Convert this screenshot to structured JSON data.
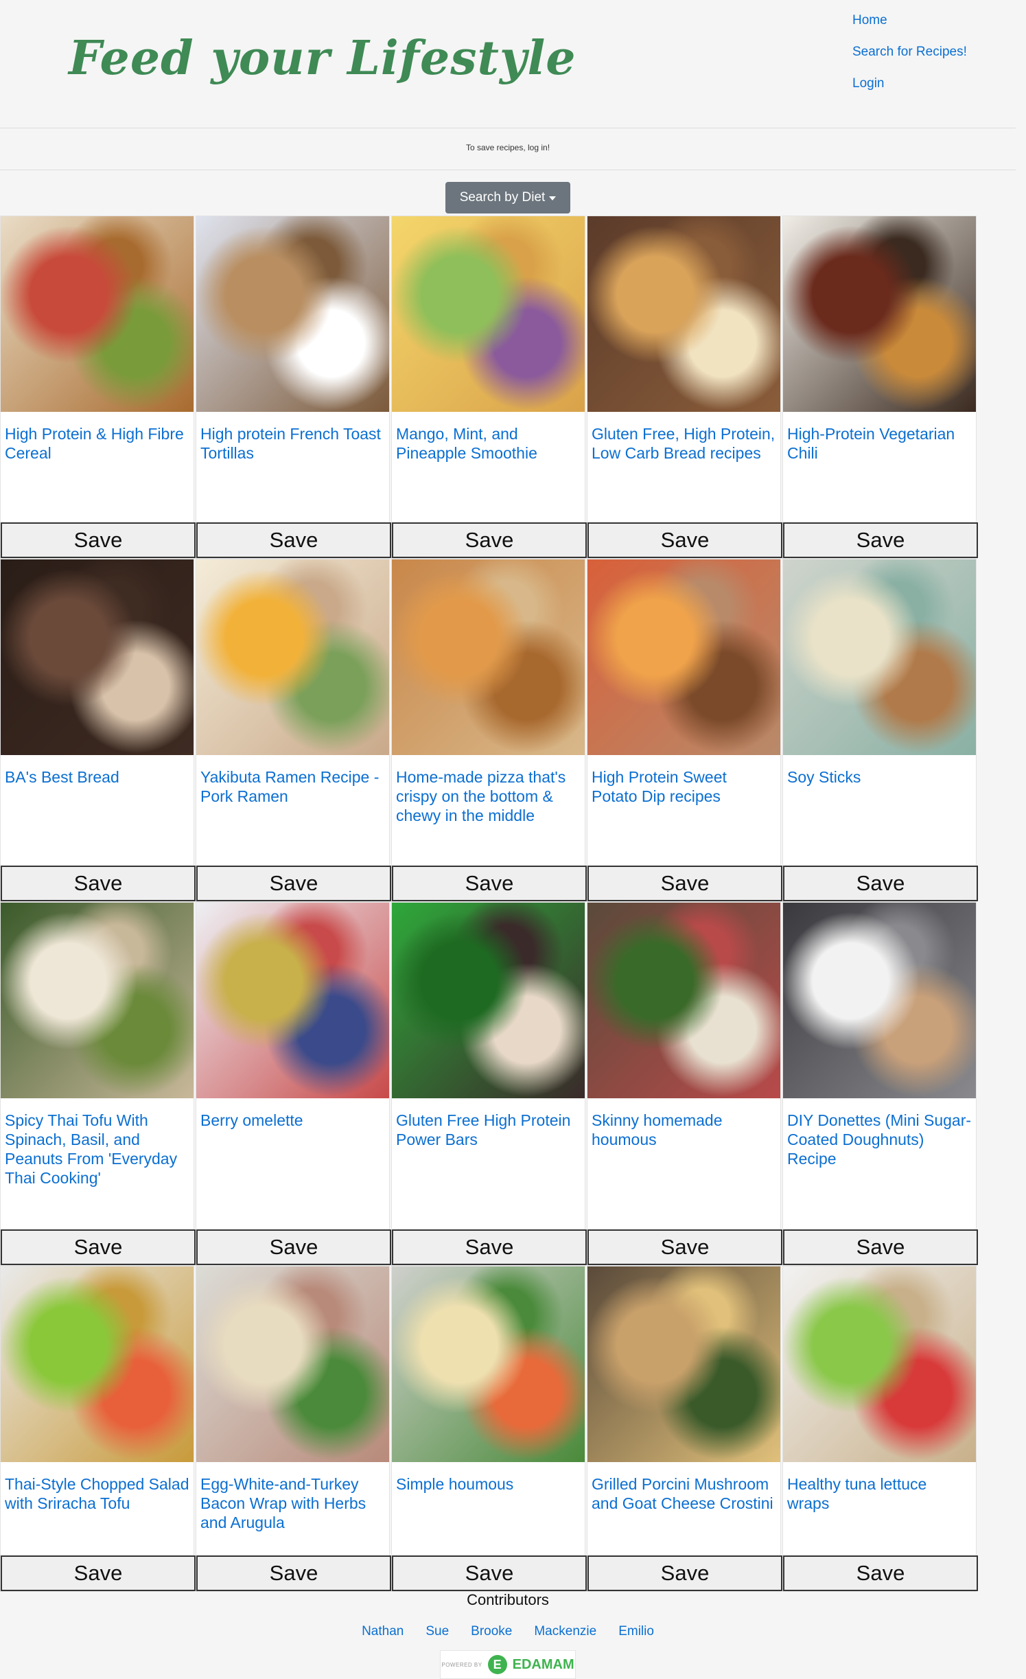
{
  "header": {
    "brand": "Feed your Lifestyle",
    "nav": [
      {
        "label": "Home"
      },
      {
        "label": "Search for Recipes!"
      },
      {
        "label": "Login"
      }
    ]
  },
  "notice": "To save recipes, log in!",
  "filter": {
    "label": "Search by Diet"
  },
  "save_label": "Save",
  "recipes": [
    {
      "title": "High Protein & High Fibre Cereal",
      "colors": [
        "#e9dcc6",
        "#c84a3a",
        "#7a9b3a",
        "#a86b2f"
      ]
    },
    {
      "title": "High protein French Toast Tortillas",
      "colors": [
        "#dfe3ee",
        "#b98f62",
        "#ffffff",
        "#7c5a3a"
      ]
    },
    {
      "title": "Mango, Mint, and Pineapple Smoothie",
      "colors": [
        "#f4d66b",
        "#8fbf5a",
        "#8a5a9c",
        "#d9a24a"
      ]
    },
    {
      "title": "Gluten Free, High Protein, Low Carb Bread recipes",
      "colors": [
        "#5b3b2a",
        "#d9a35a",
        "#f1e2c0",
        "#8a5d3a"
      ]
    },
    {
      "title": "High-Protein Vegetarian Chili",
      "colors": [
        "#f0ede6",
        "#6a2a1c",
        "#c98a3a",
        "#3a2a20"
      ]
    },
    {
      "title": "BA's Best Bread",
      "colors": [
        "#2a1d17",
        "#6b4a3a",
        "#d8c2aa",
        "#3e2b22"
      ]
    },
    {
      "title": "Yakibuta Ramen Recipe - Pork Ramen",
      "colors": [
        "#f4ecd8",
        "#f2b23a",
        "#7aa05a",
        "#c9a98a"
      ]
    },
    {
      "title": "Home-made pizza that's crispy on the bottom & chewy in the middle",
      "colors": [
        "#c9874a",
        "#e29a4a",
        "#a8692f",
        "#d8b88a"
      ]
    },
    {
      "title": "High Protein Sweet Potato Dip recipes",
      "colors": [
        "#d8603a",
        "#f0a34a",
        "#7a4a2a",
        "#b88a6a"
      ]
    },
    {
      "title": "Soy Sticks",
      "colors": [
        "#cfd4cc",
        "#e9e2c8",
        "#b07a4a",
        "#8ab0a4"
      ]
    },
    {
      "title": "Spicy Thai Tofu With Spinach, Basil, and Peanuts From 'Everyday Thai Cooking'",
      "colors": [
        "#3a5a2a",
        "#eee6d6",
        "#6b8a3a",
        "#c8b89a"
      ]
    },
    {
      "title": "Berry omelette",
      "colors": [
        "#eef0f4",
        "#c8b04a",
        "#3a4a8a",
        "#c84a4a"
      ]
    },
    {
      "title": "Gluten Free High Protein Power Bars",
      "colors": [
        "#2ea83a",
        "#1e6a22",
        "#e8d8c8",
        "#3a2a2a"
      ]
    },
    {
      "title": "Skinny homemade houmous",
      "colors": [
        "#5a4a3a",
        "#3a6a2a",
        "#e8e0d0",
        "#b84a4a"
      ]
    },
    {
      "title": "DIY Donettes (Mini Sugar-Coated Doughnuts) Recipe",
      "colors": [
        "#3a3a3e",
        "#f2f2f2",
        "#c8a07a",
        "#8a8a8e"
      ]
    },
    {
      "title": "Thai-Style Chopped Salad with Sriracha Tofu",
      "colors": [
        "#eaeaea",
        "#8ac83a",
        "#e8603a",
        "#c89a3a"
      ]
    },
    {
      "title": "Egg-White-and-Turkey Bacon Wrap with Herbs and Arugula",
      "colors": [
        "#dcdcd6",
        "#e8dcc0",
        "#4a8a3a",
        "#b88a7a"
      ]
    },
    {
      "title": "Simple houmous",
      "colors": [
        "#cfd0cc",
        "#efe0b0",
        "#e86a3a",
        "#4a8a3a"
      ]
    },
    {
      "title": "Grilled Porcini Mushroom and Goat Cheese Crostini",
      "colors": [
        "#5a4a3a",
        "#c8a06a",
        "#3a5a2a",
        "#e0c07a"
      ]
    },
    {
      "title": "Healthy tuna lettuce wraps",
      "colors": [
        "#f2f2f2",
        "#8ac84a",
        "#d83a3a",
        "#c8b08a"
      ]
    }
  ],
  "footer": {
    "heading": "Contributors",
    "contributors": [
      "Nathan",
      "Sue",
      "Brooke",
      "Mackenzie",
      "Emilio"
    ],
    "badge_small": "POWERED BY",
    "badge_word": "EDAMAM",
    "badge_mark": "E"
  }
}
